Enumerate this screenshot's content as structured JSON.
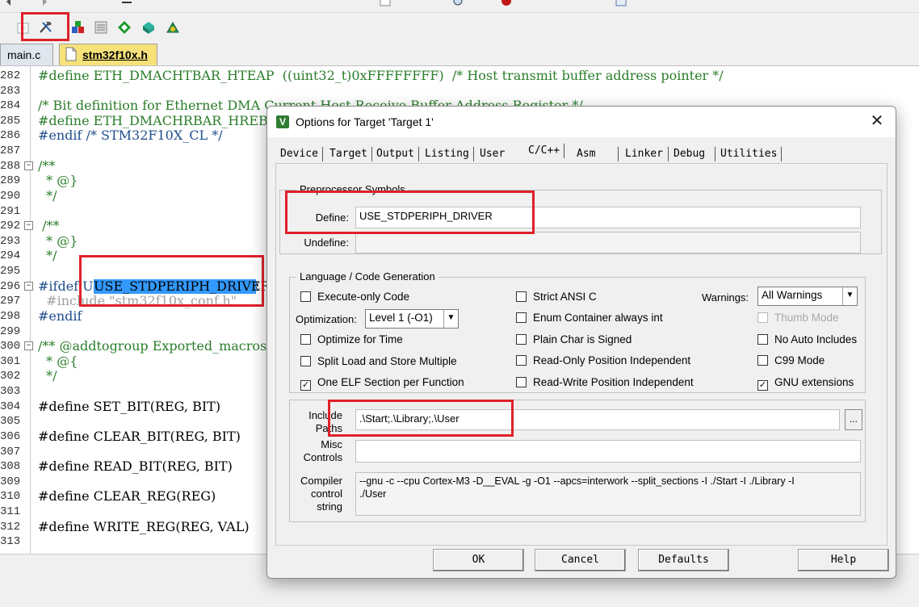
{
  "editor": {
    "tabs": [
      {
        "label": "main.c"
      },
      {
        "label": "stm32f10x.h"
      }
    ],
    "lines": [
      {
        "num": "282",
        "text": "#define ETH_DMACHTBAR_HTEAP  ((uint32_t)0xFFFFFFFF)  /* Host transmit buffer address pointer */"
      },
      {
        "num": "283",
        "text": ""
      },
      {
        "num": "284",
        "text": "/* Bit definition for Ethernet DMA Current Host Receive Buffer Address Register */"
      },
      {
        "num": "285",
        "text": "#define ETH_DMACHRBAR_HREBAP"
      },
      {
        "num": "286",
        "text": "#endif /* STM32F10X_CL */"
      },
      {
        "num": "287",
        "text": ""
      },
      {
        "num": "288",
        "text": "/**"
      },
      {
        "num": "289",
        "text": "  * @}"
      },
      {
        "num": "290",
        "text": "  */"
      },
      {
        "num": "291",
        "text": ""
      },
      {
        "num": "292",
        "text": " /**"
      },
      {
        "num": "293",
        "text": "  * @}"
      },
      {
        "num": "294",
        "text": "  */"
      },
      {
        "num": "295",
        "text": ""
      },
      {
        "num": "296",
        "text": "#ifdef USE_STDPERIPH_DRIVER"
      },
      {
        "num": "297",
        "text": "  #include \"stm32f10x_conf.h\""
      },
      {
        "num": "298",
        "text": "#endif"
      },
      {
        "num": "299",
        "text": ""
      },
      {
        "num": "300",
        "text": "/** @addtogroup Exported_macros"
      },
      {
        "num": "301",
        "text": "  * @{"
      },
      {
        "num": "302",
        "text": "  */"
      },
      {
        "num": "303",
        "text": ""
      },
      {
        "num": "304",
        "text": "#define SET_BIT(REG, BIT)"
      },
      {
        "num": "305",
        "text": ""
      },
      {
        "num": "306",
        "text": "#define CLEAR_BIT(REG, BIT)"
      },
      {
        "num": "307",
        "text": ""
      },
      {
        "num": "308",
        "text": "#define READ_BIT(REG, BIT)"
      },
      {
        "num": "309",
        "text": ""
      },
      {
        "num": "310",
        "text": "#define CLEAR_REG(REG)"
      },
      {
        "num": "311",
        "text": ""
      },
      {
        "num": "312",
        "text": "#define WRITE_REG(REG, VAL)"
      },
      {
        "num": "313",
        "text": ""
      }
    ]
  },
  "dialog": {
    "title": "Options for Target 'Target 1'",
    "close_glyph": "✕",
    "tabs": [
      "Device",
      "Target",
      "Output",
      "Listing",
      "User",
      "C/C++",
      "Asm",
      "Linker",
      "Debug",
      "Utilities"
    ],
    "active_tab": "C/C++",
    "preprocessor": {
      "group_label": "Preprocessor Symbols",
      "define_label": "Define:",
      "define_value": "USE_STDPERIPH_DRIVER",
      "undefine_label": "Undefine:",
      "undefine_value": ""
    },
    "language": {
      "group_label": "Language / Code Generation",
      "execute_only": {
        "label": "Execute-only Code",
        "checked": false
      },
      "optimization_label": "Optimization:",
      "optimization_value": "Level 1 (-O1)",
      "optimize_time": {
        "label": "Optimize for Time",
        "checked": false
      },
      "split_load": {
        "label": "Split Load and Store Multiple",
        "checked": false
      },
      "one_elf": {
        "label": "One ELF Section per Function",
        "checked": true
      },
      "strict_ansi": {
        "label": "Strict ANSI C",
        "checked": false
      },
      "enum_container": {
        "label": "Enum Container always int",
        "checked": false
      },
      "plain_char": {
        "label": "Plain Char is Signed",
        "checked": false
      },
      "ro_pi": {
        "label": "Read-Only Position Independent",
        "checked": false
      },
      "rw_pi": {
        "label": "Read-Write Position Independent",
        "checked": false
      },
      "warnings_label": "Warnings:",
      "warnings_value": "All Warnings",
      "thumb_mode": {
        "label": "Thumb Mode",
        "checked": false,
        "disabled": true
      },
      "no_auto_includes": {
        "label": "No Auto Includes",
        "checked": false
      },
      "c99": {
        "label": "C99 Mode",
        "checked": false
      },
      "gnu_ext": {
        "label": "GNU extensions",
        "checked": true
      }
    },
    "paths": {
      "include_label": "Include\nPaths",
      "include_value": ".\\Start;.\\Library;.\\User",
      "browse_label": "...",
      "misc_label": "Misc\nControls",
      "misc_value": "",
      "compiler_label": "Compiler\ncontrol\nstring",
      "compiler_value": "--gnu -c --cpu Cortex-M3 -D__EVAL -g -O1 --apcs=interwork --split_sections -I ./Start -I ./Library -I\n./User"
    },
    "buttons": {
      "ok": "OK",
      "cancel": "Cancel",
      "defaults": "Defaults",
      "help": "Help"
    }
  },
  "colors": {
    "highlight_box": "#e0202a",
    "selection": "#3399ff",
    "comment": "#2a7d2a"
  }
}
